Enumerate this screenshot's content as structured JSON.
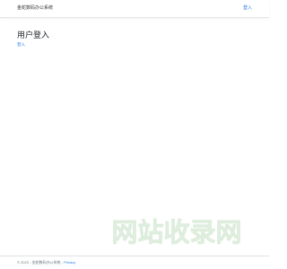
{
  "header": {
    "brand": "金蛇数码办公系统",
    "login_link": "登入"
  },
  "main": {
    "title": "用户登入",
    "login_link": "登入"
  },
  "footer": {
    "copyright": "© 2023 - 金蛇数码办公系统 - ",
    "privacy_link": "Privacy"
  },
  "watermark": {
    "text": "网站收录网"
  },
  "colors": {
    "link": "#2c7be5",
    "watermark": "#e8f3e7"
  }
}
